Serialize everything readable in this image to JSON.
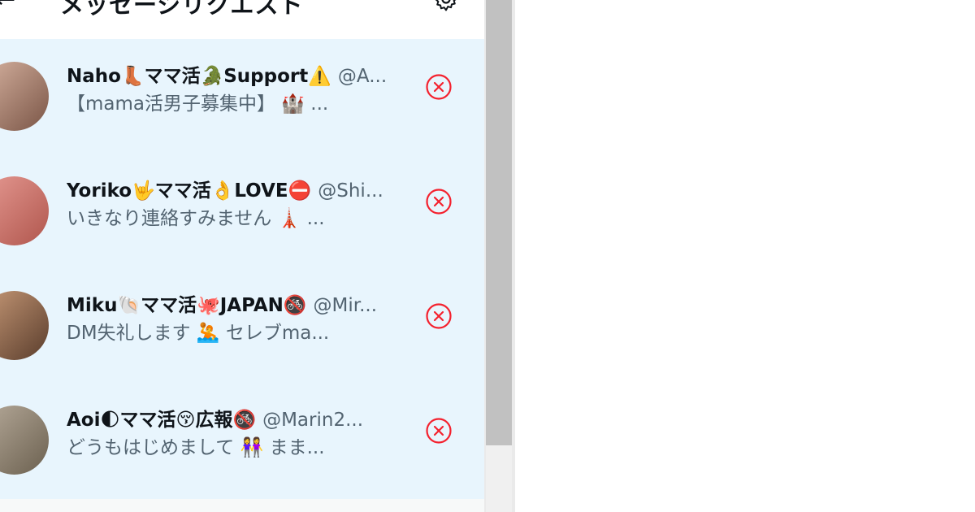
{
  "header": {
    "back_icon": "back-arrow-icon",
    "title": "メッセージリクエスト",
    "settings_icon": "gear-icon"
  },
  "requests": [
    {
      "name": "Naho👢ママ活🐊Support⚠️",
      "handle": "@A...",
      "preview": "【mama活男子募集中】 🏰 ...",
      "avatar_colors": [
        "#d7b3a1",
        "#7a5546"
      ]
    },
    {
      "name": "Yoriko🤟ママ活👌LOVE⛔",
      "handle": "@Shi...",
      "preview": "いきなり連絡すみません 🗼 ...",
      "avatar_colors": [
        "#e69a93",
        "#b0564d"
      ]
    },
    {
      "name": "Miku🐚ママ活🐙JAPAN🚳",
      "handle": "@Mir...",
      "preview": "DM失礼します 🤽 セレブma...",
      "avatar_colors": [
        "#c89a78",
        "#5a3d2c"
      ]
    },
    {
      "name": "Aoi🌓ママ活😚広報🚳",
      "handle": "@Marin2...",
      "preview": "どうもはじめまして 👭 まま...",
      "avatar_colors": [
        "#b7ab9b",
        "#6b604f"
      ]
    }
  ],
  "remove_icon": "x-circle-icon",
  "colors": {
    "list_background": "#e8f5fd",
    "remove_red": "#f4212e",
    "secondary_text": "#536471"
  }
}
